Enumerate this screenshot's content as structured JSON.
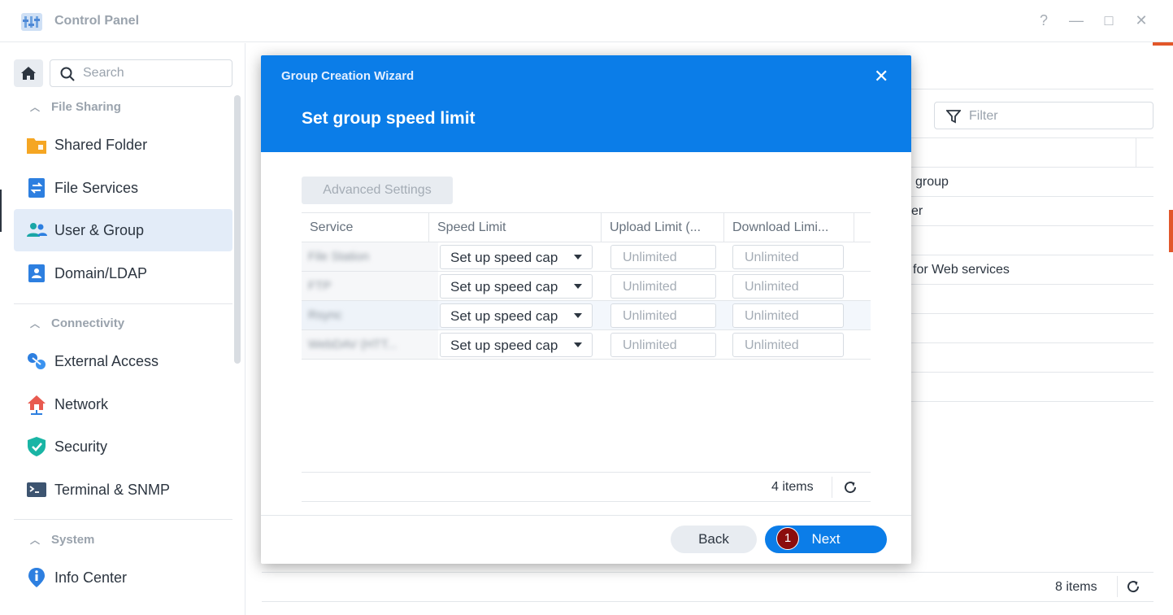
{
  "window": {
    "title": "Control Panel",
    "controls": [
      "?",
      "—",
      "□",
      "✕"
    ]
  },
  "sidebar": {
    "search_placeholder": "Search",
    "sections": [
      {
        "label": "File Sharing",
        "items": [
          {
            "label": "Shared Folder",
            "icon": "folder-icon"
          },
          {
            "label": "File Services",
            "icon": "file-services-icon"
          },
          {
            "label": "User & Group",
            "icon": "users-icon",
            "active": true
          },
          {
            "label": "Domain/LDAP",
            "icon": "domain-icon"
          }
        ]
      },
      {
        "label": "Connectivity",
        "items": [
          {
            "label": "External Access",
            "icon": "external-access-icon"
          },
          {
            "label": "Network",
            "icon": "network-icon"
          },
          {
            "label": "Security",
            "icon": "shield-icon"
          },
          {
            "label": "Terminal & SNMP",
            "icon": "terminal-icon"
          }
        ]
      },
      {
        "label": "System",
        "items": [
          {
            "label": "Info Center",
            "icon": "info-icon"
          }
        ]
      }
    ]
  },
  "background": {
    "filter_placeholder": "Filter",
    "rows": [
      "group",
      "er",
      "",
      "for Web services"
    ],
    "footer_count": "8 items"
  },
  "dialog": {
    "title": "Group Creation Wizard",
    "step_title": "Set group speed limit",
    "advanced_label": "Advanced Settings",
    "columns": [
      "Service",
      "Speed Limit",
      "Upload Limit (...",
      "Download Limi..."
    ],
    "rows": [
      {
        "service": "File Station",
        "speed": "Set up speed cap",
        "upload": "Unlimited",
        "download": "Unlimited"
      },
      {
        "service": "FTP",
        "speed": "Set up speed cap",
        "upload": "Unlimited",
        "download": "Unlimited"
      },
      {
        "service": "Rsync",
        "speed": "Set up speed cap",
        "upload": "Unlimited",
        "download": "Unlimited"
      },
      {
        "service": "WebDAV (HTT...",
        "speed": "Set up speed cap",
        "upload": "Unlimited",
        "download": "Unlimited"
      }
    ],
    "footer_count": "4 items",
    "back_label": "Back",
    "next_label": "Next",
    "step_badge": "1"
  },
  "colors": {
    "accent": "#0b7de8",
    "badge": "#8b0d0d"
  }
}
